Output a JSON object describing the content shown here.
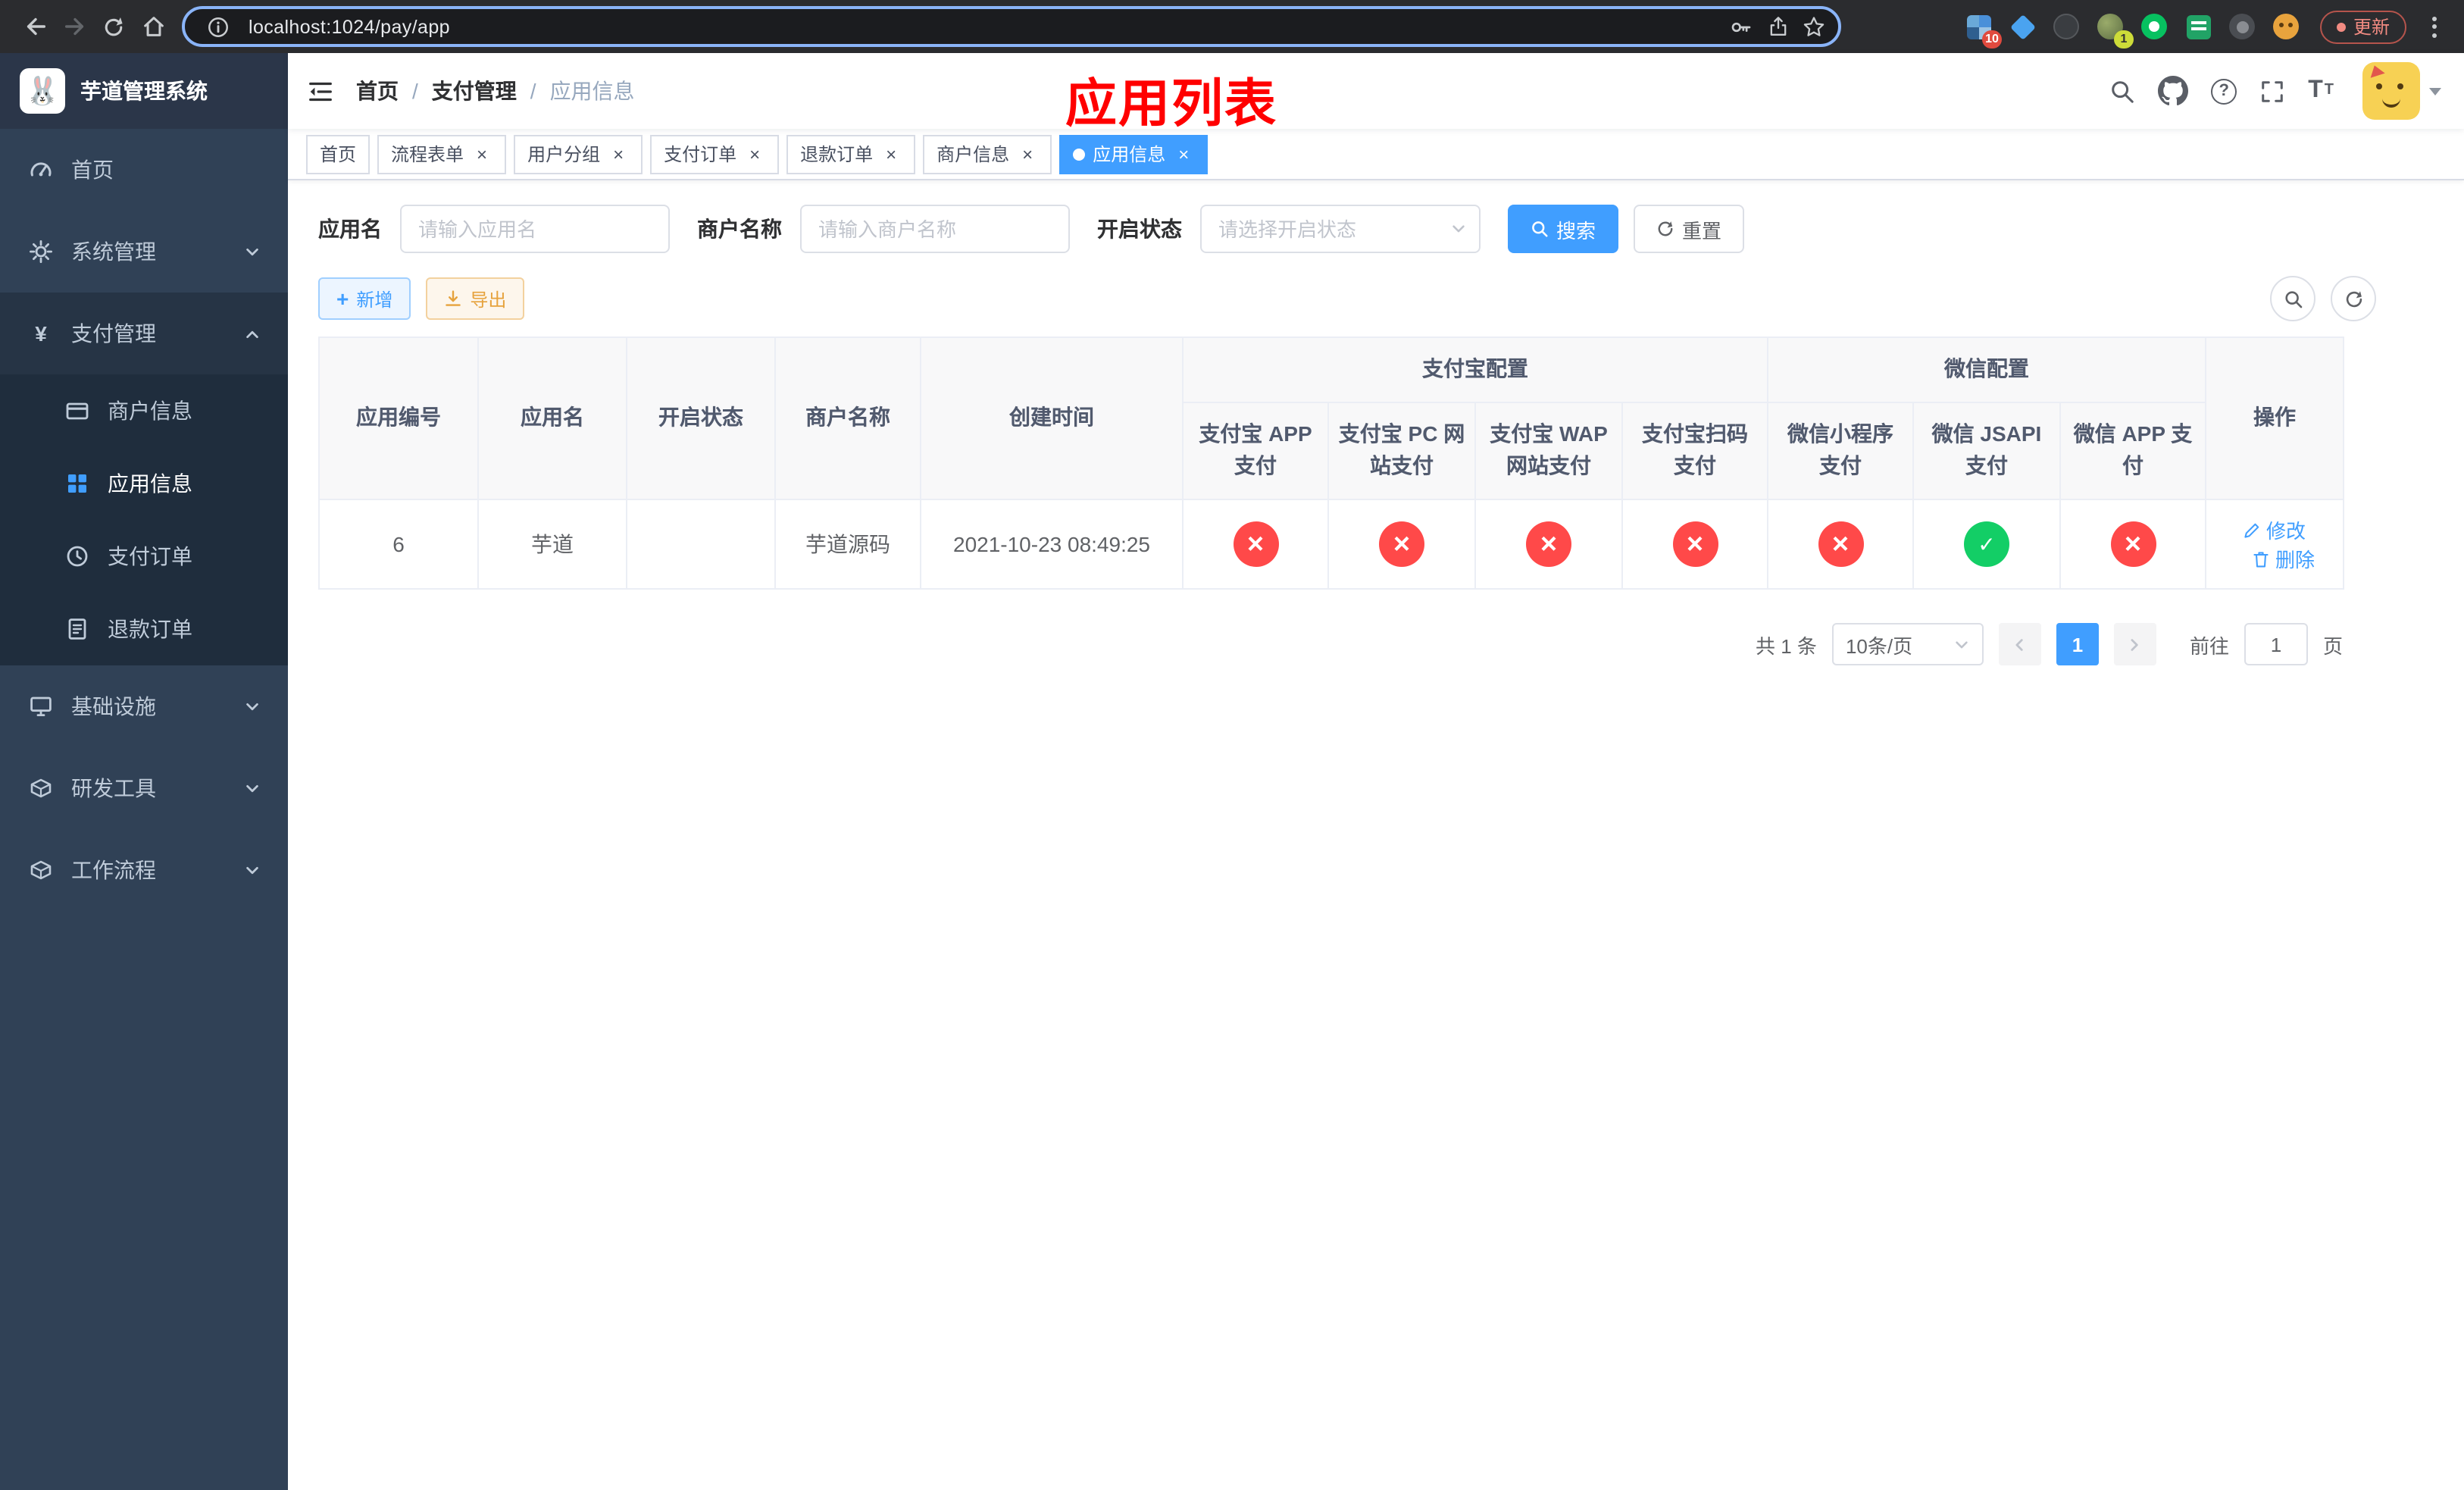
{
  "browser": {
    "url": "localhost:1024/pay/app",
    "update_label": "更新",
    "ext_badge_blocks": "10",
    "ext_badge_avatar": "1"
  },
  "sidebar": {
    "logo_title": "芋道管理系统",
    "items": [
      {
        "label": "首页"
      },
      {
        "label": "系统管理"
      },
      {
        "label": "支付管理",
        "children": [
          {
            "label": "商户信息"
          },
          {
            "label": "应用信息"
          },
          {
            "label": "支付订单"
          },
          {
            "label": "退款订单"
          }
        ]
      },
      {
        "label": "基础设施"
      },
      {
        "label": "研发工具"
      },
      {
        "label": "工作流程"
      }
    ]
  },
  "navbar": {
    "breadcrumb": {
      "home": "首页",
      "section": "支付管理",
      "current": "应用信息"
    },
    "annotation": "应用列表"
  },
  "tags": [
    {
      "label": "首页"
    },
    {
      "label": "流程表单"
    },
    {
      "label": "用户分组"
    },
    {
      "label": "支付订单"
    },
    {
      "label": "退款订单"
    },
    {
      "label": "商户信息"
    },
    {
      "label": "应用信息"
    }
  ],
  "search": {
    "app_name_label": "应用名",
    "app_name_placeholder": "请输入应用名",
    "merchant_label": "商户名称",
    "merchant_placeholder": "请输入商户名称",
    "status_label": "开启状态",
    "status_placeholder": "请选择开启状态",
    "search_button": "搜索",
    "reset_button": "重置"
  },
  "toolbar": {
    "add_button": "新增",
    "export_button": "导出"
  },
  "table": {
    "headers": {
      "app_id": "应用编号",
      "app_name": "应用名",
      "status": "开启状态",
      "merchant": "商户名称",
      "created": "创建时间",
      "alipay_group": "支付宝配置",
      "wechat_group": "微信配置",
      "alipay_app": "支付宝 APP 支付",
      "alipay_pc": "支付宝 PC 网站支付",
      "alipay_wap": "支付宝 WAP 网站支付",
      "alipay_qr": "支付宝扫码支付",
      "wechat_mini": "微信小程序支付",
      "wechat_jsapi": "微信 JSAPI 支付",
      "wechat_app": "微信 APP 支付",
      "actions": "操作"
    },
    "row": {
      "id": "6",
      "name": "芋道",
      "enabled": "on",
      "merchant": "芋道源码",
      "created": "2021-10-23 08:49:25",
      "channels": [
        "cross",
        "cross",
        "cross",
        "cross",
        "cross",
        "check",
        "cross"
      ],
      "edit_label": "修改",
      "delete_label": "删除"
    }
  },
  "pagination": {
    "total": "共 1 条",
    "page_size": "10条/页",
    "page": "1",
    "goto_label": "前往",
    "goto_value": "1",
    "unit_label": "页"
  }
}
